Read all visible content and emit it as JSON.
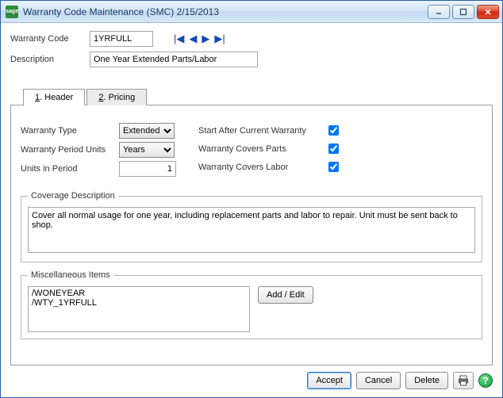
{
  "window": {
    "title": "Warranty Code Maintenance (SMC) 2/15/2013",
    "app_icon_text": "sage"
  },
  "fields": {
    "warranty_code_label": "Warranty Code",
    "warranty_code_value": "1YRFULL",
    "description_label": "Description",
    "description_value": "One Year Extended Parts/Labor"
  },
  "tabs": {
    "header": "Header",
    "header_accel": "1",
    "pricing": "Pricing",
    "pricing_accel": "2"
  },
  "header_form": {
    "warranty_type_label": "Warranty Type",
    "warranty_type_value": "Extended",
    "period_units_label": "Warranty Period Units",
    "period_units_value": "Years",
    "units_in_period_label": "Units in Period",
    "units_in_period_value": "1",
    "start_after_label": "Start After Current Warranty",
    "start_after_checked": true,
    "covers_parts_label": "Warranty Covers Parts",
    "covers_parts_checked": true,
    "covers_labor_label": "Warranty Covers Labor",
    "covers_labor_checked": true
  },
  "coverage": {
    "legend": "Coverage Description",
    "text": "Cover all normal usage for one year, including replacement parts and labor to repair. Unit must be sent back to shop."
  },
  "misc": {
    "legend": "Miscellaneous Items",
    "items": [
      "/WONEYEAR",
      "/WTY_1YRFULL"
    ],
    "add_edit_label": "Add / Edit"
  },
  "footer": {
    "accept": "Accept",
    "cancel": "Cancel",
    "delete": "Delete"
  }
}
